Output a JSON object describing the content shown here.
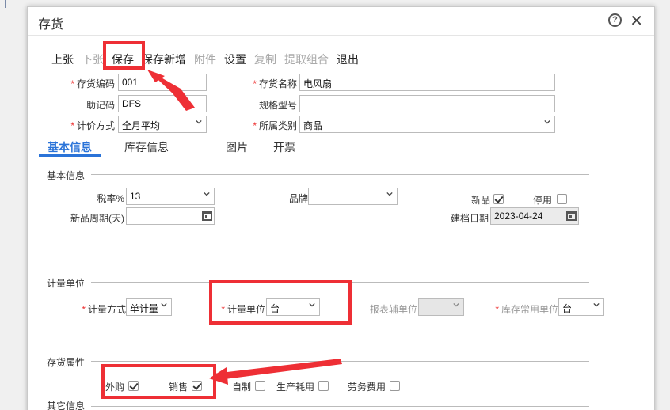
{
  "window": {
    "title": "存货",
    "help_icon": "?",
    "close_icon": "✕"
  },
  "toolbar": {
    "items": [
      {
        "label": "上张",
        "enabled": true
      },
      {
        "label": "下张",
        "enabled": false
      },
      {
        "label": "保存",
        "enabled": true
      },
      {
        "label": "保存新增",
        "enabled": true
      },
      {
        "label": "附件",
        "enabled": false
      },
      {
        "label": "设置",
        "enabled": true
      },
      {
        "label": "复制",
        "enabled": false
      },
      {
        "label": "提取组合",
        "enabled": false
      },
      {
        "label": "退出",
        "enabled": true
      }
    ]
  },
  "form": {
    "code_label": "存货编码",
    "code_value": "001",
    "name_label": "存货名称",
    "name_value": "电风扇",
    "mnemonic_label": "助记码",
    "mnemonic_value": "DFS",
    "spec_label": "规格型号",
    "spec_value": "",
    "pricing_label": "计价方式",
    "pricing_value": "全月平均",
    "category_label": "所属类别",
    "category_value": "商品"
  },
  "tabs": [
    {
      "label": "基本信息",
      "active": true
    },
    {
      "label": "库存信息",
      "active": false
    },
    {
      "label": "图片",
      "active": false
    },
    {
      "label": "开票",
      "active": false
    }
  ],
  "basic": {
    "section_title": "基本信息",
    "tax_label": "税率%",
    "tax_value": "13",
    "brand_label": "品牌",
    "brand_value": "",
    "new_label": "新品",
    "new_checked": true,
    "disabled_label": "停用",
    "disabled_checked": false,
    "new_period_label": "新品周期(天)",
    "new_period_value": "",
    "created_label": "建档日期",
    "created_value": "2023-04-24"
  },
  "unit": {
    "section_title": "计量单位",
    "method_label": "计量方式",
    "method_value": "单计量",
    "unit_label": "计量单位",
    "unit_value": "台",
    "report_aux_label": "报表辅单位",
    "report_aux_value": "",
    "stock_unit_label": "库存常用单位",
    "stock_unit_value": "台"
  },
  "attributes": {
    "section_title": "存货属性",
    "items": [
      {
        "label": "外购",
        "checked": true
      },
      {
        "label": "销售",
        "checked": true
      },
      {
        "label": "自制",
        "checked": false
      },
      {
        "label": "生产耗用",
        "checked": false
      },
      {
        "label": "劳务费用",
        "checked": false
      }
    ]
  },
  "other": {
    "section_title": "其它信息"
  },
  "colors": {
    "highlight": "#ee2f35",
    "tab_active": "#2a73d8",
    "required": "#e33333"
  }
}
